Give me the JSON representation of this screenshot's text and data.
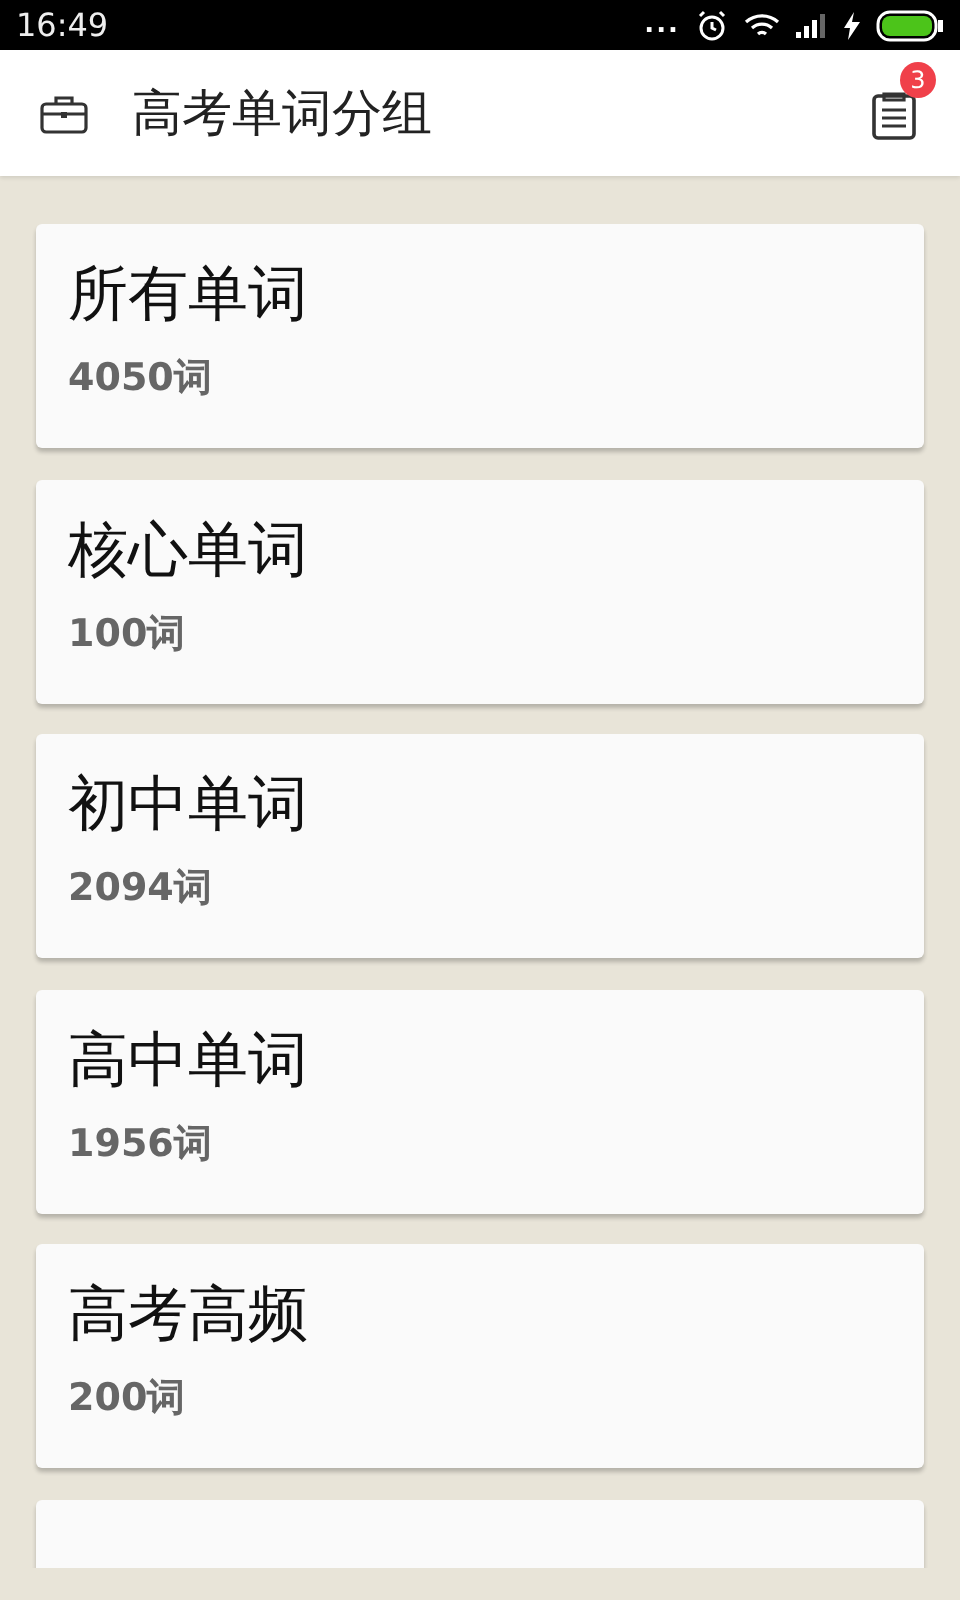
{
  "status_bar": {
    "time": "16:49",
    "dots": "..."
  },
  "header": {
    "title": "高考单词分组",
    "badge": "3"
  },
  "groups": [
    {
      "kind": "full",
      "name": "所有单词",
      "count": "4050词"
    },
    {
      "kind": "full",
      "name": "核心单词",
      "count": "100词"
    },
    {
      "kind": "full",
      "name": "初中单词",
      "count": "2094词"
    },
    {
      "kind": "full",
      "name": "高中单词",
      "count": "1956词"
    },
    {
      "kind": "full",
      "name": "高考高频",
      "count": "200词"
    },
    {
      "kind": "cut-off"
    }
  ]
}
